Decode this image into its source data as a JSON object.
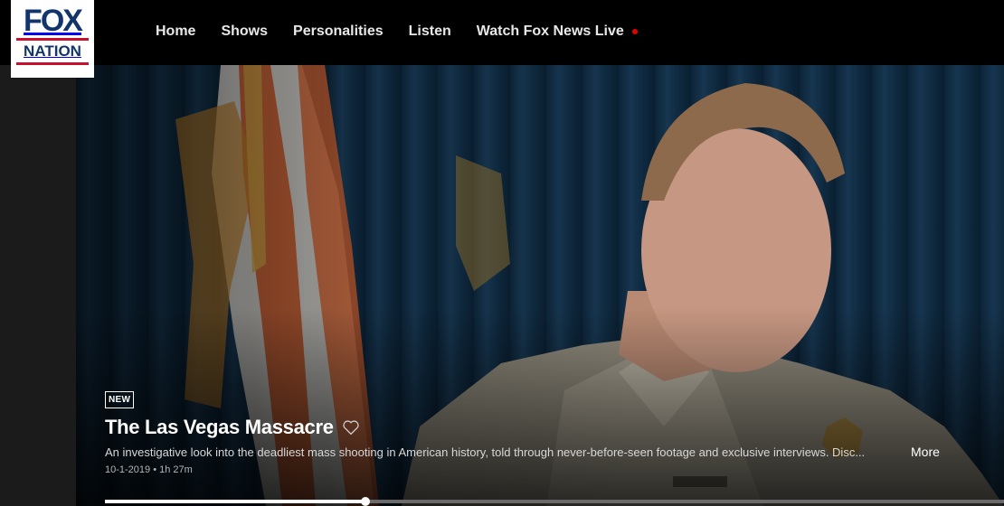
{
  "brand": {
    "logo_top": "FOX",
    "logo_bottom": "NATION"
  },
  "nav": {
    "items": [
      {
        "label": "Home"
      },
      {
        "label": "Shows"
      },
      {
        "label": "Personalities"
      },
      {
        "label": "Listen"
      },
      {
        "label": "Watch Fox News Live"
      }
    ],
    "live_indicator_color": "#e10600"
  },
  "hero": {
    "badge": "NEW",
    "title": "The Las Vegas Massacre",
    "favorite_icon": "heart-outline-icon",
    "description": "An investigative look into the deadliest mass shooting in American history, told through never-before-seen footage and exclusive interviews. Disc...",
    "more_label": "More",
    "meta": "10-1-2019 • 1h 27m",
    "progress_fraction": 0.29
  }
}
